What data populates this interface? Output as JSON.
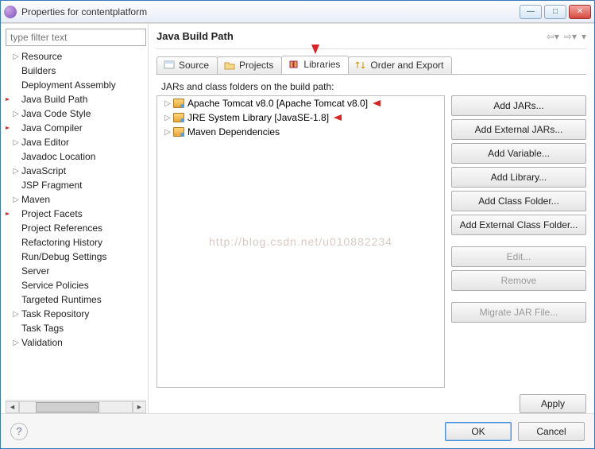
{
  "window": {
    "title": "Properties for contentplatform"
  },
  "sidebar": {
    "filter_placeholder": "type filter text",
    "items": [
      {
        "label": "Resource",
        "expandable": true
      },
      {
        "label": "Builders",
        "expandable": false
      },
      {
        "label": "Deployment Assembly",
        "expandable": false
      },
      {
        "label": "Java Build Path",
        "expandable": false,
        "red_arrow": true
      },
      {
        "label": "Java Code Style",
        "expandable": true
      },
      {
        "label": "Java Compiler",
        "expandable": false,
        "red_arrow": true
      },
      {
        "label": "Java Editor",
        "expandable": true
      },
      {
        "label": "Javadoc Location",
        "expandable": false
      },
      {
        "label": "JavaScript",
        "expandable": true
      },
      {
        "label": "JSP Fragment",
        "expandable": false
      },
      {
        "label": "Maven",
        "expandable": true
      },
      {
        "label": "Project Facets",
        "expandable": false,
        "red_arrow": true
      },
      {
        "label": "Project References",
        "expandable": false
      },
      {
        "label": "Refactoring History",
        "expandable": false
      },
      {
        "label": "Run/Debug Settings",
        "expandable": false
      },
      {
        "label": "Server",
        "expandable": false
      },
      {
        "label": "Service Policies",
        "expandable": false
      },
      {
        "label": "Targeted Runtimes",
        "expandable": false
      },
      {
        "label": "Task Repository",
        "expandable": true
      },
      {
        "label": "Task Tags",
        "expandable": false
      },
      {
        "label": "Validation",
        "expandable": true
      }
    ]
  },
  "main": {
    "heading": "Java Build Path",
    "tabs": {
      "source": "Source",
      "projects": "Projects",
      "libraries": "Libraries",
      "order": "Order and Export",
      "active": "libraries"
    },
    "libraries": {
      "prompt": "JARs and class folders on the build path:",
      "entries": [
        {
          "label": "Apache Tomcat v8.0 [Apache Tomcat v8.0]",
          "red_arrow": true
        },
        {
          "label": "JRE System Library [JavaSE-1.8]",
          "red_arrow": true
        },
        {
          "label": "Maven Dependencies",
          "red_arrow": false
        }
      ],
      "buttons": {
        "add_jars": "Add JARs...",
        "add_ext_jars": "Add External JARs...",
        "add_variable": "Add Variable...",
        "add_library": "Add Library...",
        "add_class_folder": "Add Class Folder...",
        "add_ext_class_folder": "Add External Class Folder...",
        "edit": "Edit...",
        "remove": "Remove",
        "migrate": "Migrate JAR File..."
      }
    },
    "apply": "Apply"
  },
  "footer": {
    "ok": "OK",
    "cancel": "Cancel"
  },
  "watermark": "http://blog.csdn.net/u010882234"
}
